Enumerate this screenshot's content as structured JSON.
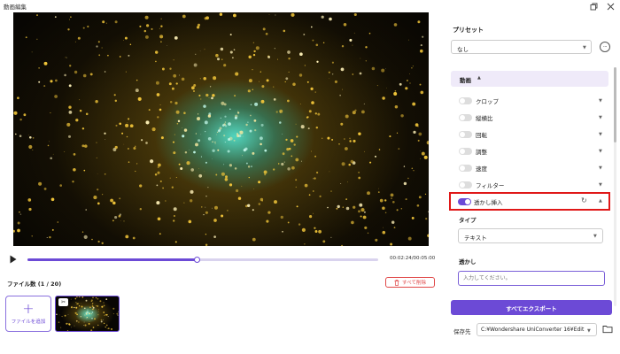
{
  "window": {
    "title": "動画編集"
  },
  "player": {
    "progress": 0.485,
    "time_text": "00:02:24/00:05:00"
  },
  "files": {
    "count_label": "ファイル数 (1 / 20)",
    "delete_all_label": "すべて削除",
    "add_label": "ファイルを追加"
  },
  "panel": {
    "preset_title": "プリセット",
    "preset_value": "なし",
    "section_title": "動画",
    "options": [
      {
        "label": "クロップ",
        "enabled": false
      },
      {
        "label": "縦横比",
        "enabled": false
      },
      {
        "label": "回転",
        "enabled": false
      },
      {
        "label": "調整",
        "enabled": false
      },
      {
        "label": "速度",
        "enabled": false
      },
      {
        "label": "フィルター",
        "enabled": false
      },
      {
        "label": "透かし挿入",
        "enabled": true
      }
    ],
    "type_title": "タイプ",
    "type_value": "テキスト",
    "watermark_title": "透かし",
    "watermark_placeholder": "入力してください。",
    "export_label": "すべてエクスポート",
    "save_label": "保存先",
    "save_path": "C:¥Wondershare UniConverter 16¥Edit"
  },
  "colors": {
    "accent": "#6c4ad6",
    "highlight": "#e01818",
    "danger": "#e04848"
  }
}
